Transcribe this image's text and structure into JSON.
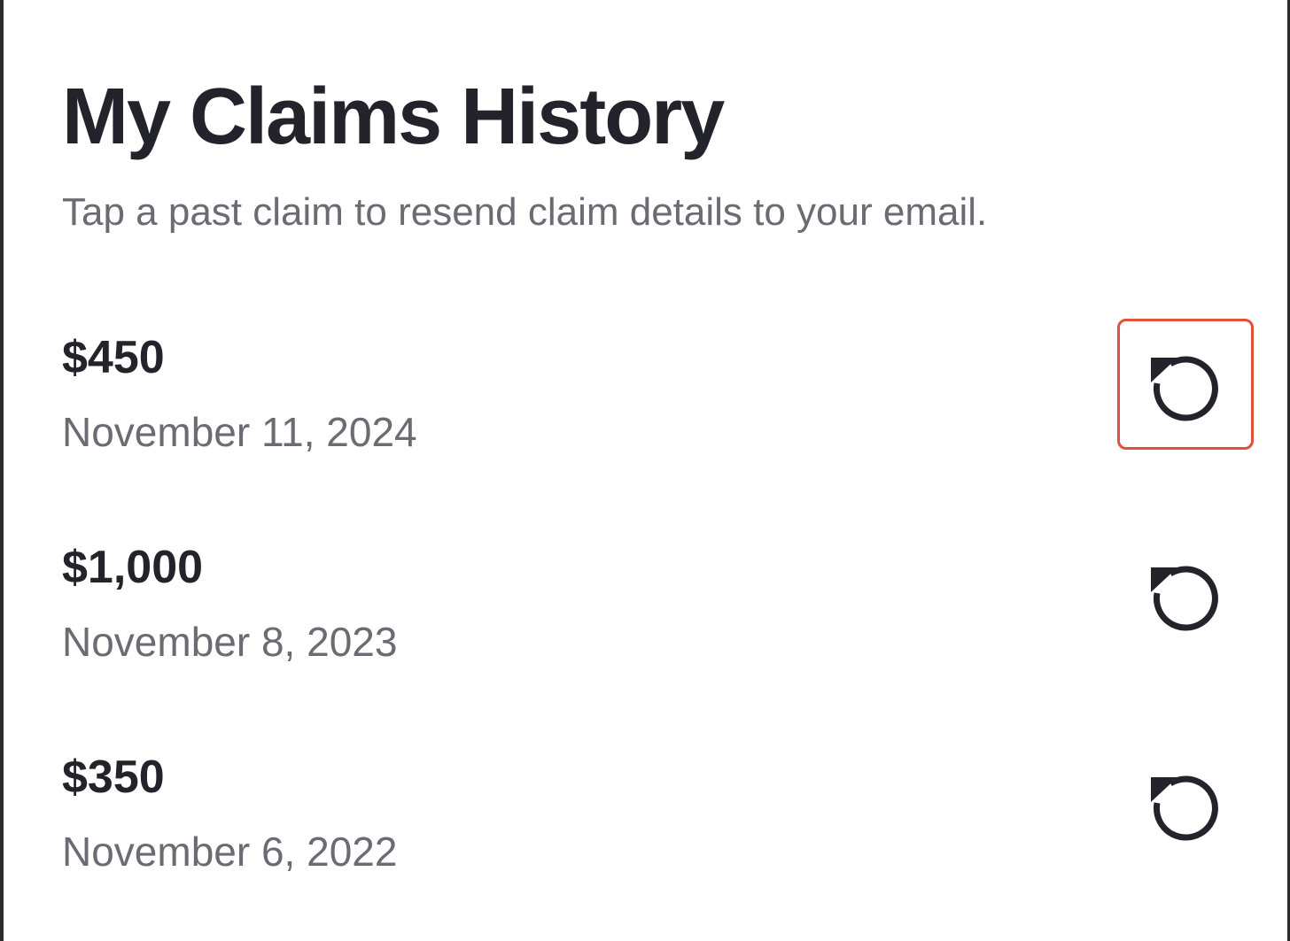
{
  "header": {
    "title": "My Claims History",
    "subtitle": "Tap a past claim to resend claim details to your email."
  },
  "claims": [
    {
      "amount": "$450",
      "date": "November 11, 2024",
      "action_icon": "resend-icon",
      "highlighted": true
    },
    {
      "amount": "$1,000",
      "date": "November 8, 2023",
      "action_icon": "resend-icon",
      "highlighted": false
    },
    {
      "amount": "$350",
      "date": "November 6, 2022",
      "action_icon": "resend-icon",
      "highlighted": false
    }
  ],
  "colors": {
    "text_primary": "#23232b",
    "text_secondary": "#6b6b73",
    "highlight_border": "#e0503c"
  }
}
